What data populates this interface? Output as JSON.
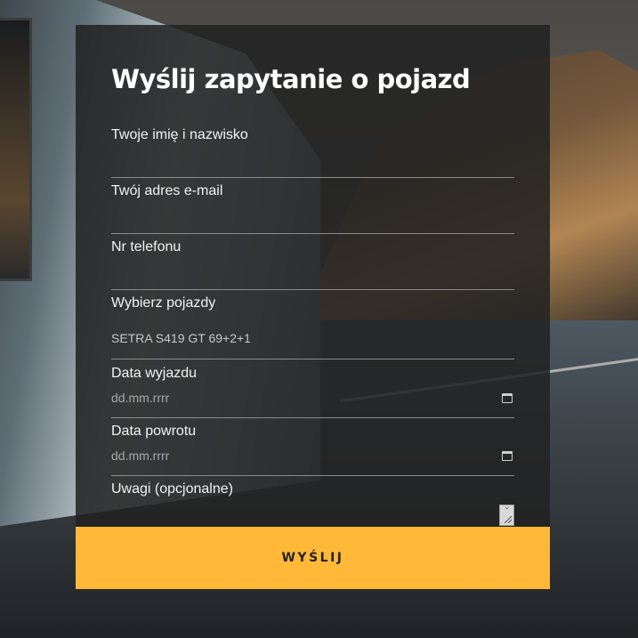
{
  "form": {
    "title": "Wyślij zapytanie o pojazd",
    "fields": {
      "name": {
        "label": "Twoje imię i nazwisko",
        "value": ""
      },
      "email": {
        "label": "Twój adres e-mail",
        "value": ""
      },
      "phone": {
        "label": "Nr telefonu",
        "value": ""
      },
      "vehicle": {
        "label": "Wybierz pojazdy",
        "value": "SETRA S419 GT 69+2+1"
      },
      "departure": {
        "label": "Data wyjazdu",
        "placeholder": "dd.mm.rrrr"
      },
      "return": {
        "label": "Data powrotu",
        "placeholder": "dd.mm.rrrr"
      },
      "notes": {
        "label": "Uwagi (opcjonalne)",
        "value": ""
      }
    },
    "submit_label": "WYŚLIJ"
  },
  "colors": {
    "accent": "#ffb837",
    "panel": "#222222",
    "text": "#ffffff"
  },
  "icons": [
    "calendar-icon",
    "resize-handle-icon"
  ]
}
